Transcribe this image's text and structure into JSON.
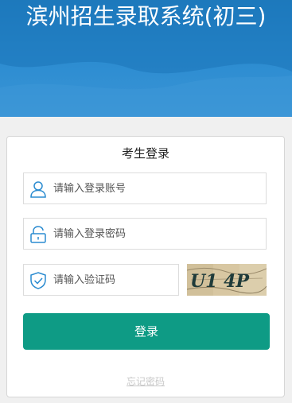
{
  "header": {
    "title": "滨州招生录取系统(初三)"
  },
  "login": {
    "heading": "考生登录",
    "account": {
      "placeholder": "请输入登录账号",
      "icon": "user-icon"
    },
    "password": {
      "placeholder": "请输入登录密码",
      "icon": "lock-icon"
    },
    "captcha": {
      "placeholder": "请输入验证码",
      "icon": "shield-check-icon",
      "image_text": "U1 4P"
    },
    "submit_label": "登录",
    "forgot_label": "忘记密码"
  },
  "colors": {
    "banner": "#2a8bd0",
    "accent": "#0e9b85",
    "icon": "#2a8bd0"
  }
}
